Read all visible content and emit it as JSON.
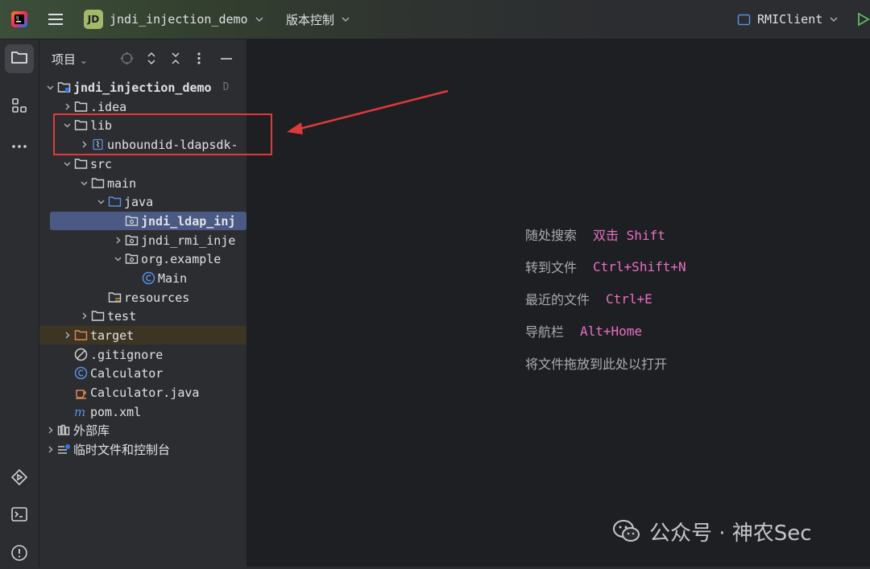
{
  "titlebar": {
    "project_badge": "JD",
    "project_name": "jndi_injection_demo",
    "vcs_label": "版本控制",
    "run_config": "RMIClient"
  },
  "project_panel": {
    "title": "项目",
    "tree": [
      {
        "label": "jndi_injection_demo",
        "hint": "D",
        "icon": "module-folder-icon",
        "expanded": true
      },
      {
        "label": ".idea",
        "icon": "folder-icon",
        "expanded": false
      },
      {
        "label": "lib",
        "icon": "folder-icon",
        "expanded": true
      },
      {
        "label": "unboundid-ldapsdk-",
        "icon": "jar-library-icon",
        "expanded": false
      },
      {
        "label": "src",
        "icon": "folder-icon",
        "expanded": true
      },
      {
        "label": "main",
        "icon": "folder-icon",
        "expanded": true
      },
      {
        "label": "java",
        "icon": "source-folder-icon",
        "expanded": true
      },
      {
        "label": "jndi_ldap_inj",
        "icon": "package-icon",
        "selected": true
      },
      {
        "label": "jndi_rmi_inje",
        "icon": "package-icon",
        "expanded": false
      },
      {
        "label": "org.example",
        "icon": "package-icon",
        "expanded": true
      },
      {
        "label": "Main",
        "icon": "class-icon"
      },
      {
        "label": "resources",
        "icon": "resources-folder-icon"
      },
      {
        "label": "test",
        "icon": "folder-icon",
        "expanded": false
      },
      {
        "label": "target",
        "icon": "excluded-folder-icon",
        "expanded": false
      },
      {
        "label": ".gitignore",
        "icon": "ignore-file-icon"
      },
      {
        "label": "Calculator",
        "icon": "class-icon"
      },
      {
        "label": "Calculator.java",
        "icon": "java-file-icon"
      },
      {
        "label": "pom.xml",
        "icon": "maven-icon"
      },
      {
        "label": "外部库",
        "icon": "external-libraries-icon",
        "expanded": false
      },
      {
        "label": "临时文件和控制台",
        "icon": "scratches-icon",
        "expanded": false
      }
    ]
  },
  "editor_empty_state": [
    {
      "label": "随处搜索",
      "key_prefix": "双击",
      "key": "Shift"
    },
    {
      "label": "转到文件",
      "key": "Ctrl+Shift+N"
    },
    {
      "label": "最近的文件",
      "key": "Ctrl+E"
    },
    {
      "label": "导航栏",
      "key": "Alt+Home"
    },
    {
      "label": "将文件拖放到此处以打开"
    }
  ],
  "watermark": "公众号 · 神农Sec",
  "colors": {
    "accent_selection": "#4b5a85",
    "shortcut_key": "#e86fc2",
    "annotation_red": "#e0393b",
    "project_badge": "#a3b869"
  }
}
